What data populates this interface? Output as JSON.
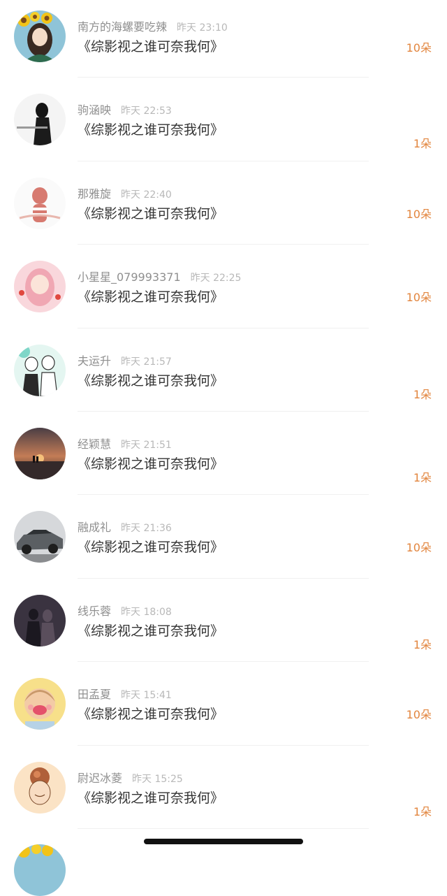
{
  "records": [
    {
      "name": "南方的海螺要吃辣",
      "time": "昨天 23:10",
      "title": "《综影视之谁可奈我何》",
      "count": "10朵",
      "avatar": "avatar-girl-sunflower"
    },
    {
      "name": "驹涵映",
      "time": "昨天 22:53",
      "title": "《综影视之谁可奈我何》",
      "count": "1朵",
      "avatar": "avatar-person-white"
    },
    {
      "name": "那雅旋",
      "time": "昨天 22:40",
      "title": "《综影视之谁可奈我何》",
      "count": "10朵",
      "avatar": "avatar-cartoon-striped"
    },
    {
      "name": "小星星_079993371",
      "time": "昨天 22:25",
      "title": "《综影视之谁可奈我何》",
      "count": "10朵",
      "avatar": "avatar-pink-girl"
    },
    {
      "name": "夫运升",
      "time": "昨天 21:57",
      "title": "《综影视之谁可奈我何》",
      "count": "1朵",
      "avatar": "avatar-anime-boys"
    },
    {
      "name": "经颖慧",
      "time": "昨天 21:51",
      "title": "《综影视之谁可奈我何》",
      "count": "1朵",
      "avatar": "avatar-sunset"
    },
    {
      "name": "融成礼",
      "time": "昨天 21:36",
      "title": "《综影视之谁可奈我何》",
      "count": "10朵",
      "avatar": "avatar-car"
    },
    {
      "name": "线乐蓉",
      "time": "昨天 18:08",
      "title": "《综影视之谁可奈我何》",
      "count": "1朵",
      "avatar": "avatar-couple-night"
    },
    {
      "name": "田孟夏",
      "time": "昨天 15:41",
      "title": "《综影视之谁可奈我何》",
      "count": "10朵",
      "avatar": "avatar-cartoon-blush"
    },
    {
      "name": "尉迟冰菱",
      "time": "昨天 15:25",
      "title": "《综影视之谁可奈我何》",
      "count": "1朵",
      "avatar": "avatar-cartoon-flower"
    }
  ],
  "colors": {
    "name": "#8f8f8f",
    "time": "#b8b8b8",
    "title": "#333333",
    "count": "#e2853e",
    "background": "#ffffff"
  }
}
